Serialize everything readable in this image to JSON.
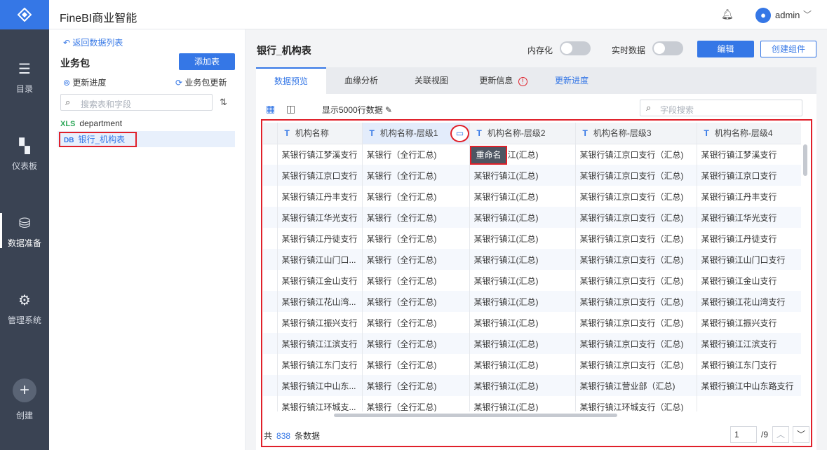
{
  "app": {
    "title": "FineBI商业智能",
    "user": "admin"
  },
  "nav": [
    {
      "label": "目录",
      "icon": "list-icon"
    },
    {
      "label": "仪表板",
      "icon": "dashboard-icon"
    },
    {
      "label": "数据准备",
      "icon": "database-icon"
    },
    {
      "label": "管理系统",
      "icon": "gear-icon"
    },
    {
      "label": "创建",
      "icon": "plus-icon"
    }
  ],
  "sidebar": {
    "back": "返回数据列表",
    "title": "业务包",
    "add_table": "添加表",
    "update_progress": "更新进度",
    "pkg_update": "业务包更新",
    "search_placeholder": "搜索表和字段",
    "items": [
      {
        "label": "department",
        "icon": "xls-icon"
      },
      {
        "label": "银行_机构表",
        "icon": "db-icon"
      }
    ]
  },
  "header": {
    "table_title": "银行_机构表",
    "memory": "内存化",
    "realtime": "实时数据",
    "edit": "编辑",
    "create": "创建组件"
  },
  "tabs": [
    "数据预览",
    "血缘分析",
    "关联视图",
    "更新信息",
    "更新进度"
  ],
  "toolbar": {
    "rows": "显示5000行数据",
    "search_placeholder": "字段搜索"
  },
  "table": {
    "columns": [
      "机构名称",
      "机构名称-层级1",
      "机构名称-层级2",
      "机构名称-层级3",
      "机构名称-层级4"
    ],
    "rows": [
      [
        "某银行镇江梦溪支行",
        "某银行（全行汇总)",
        "某银行镇江(汇总)",
        "某银行镇江京口支行（汇总)",
        "某银行镇江梦溪支行"
      ],
      [
        "某银行镇江京口支行",
        "某银行（全行汇总)",
        "某银行镇江(汇总)",
        "某银行镇江京口支行（汇总)",
        "某银行镇江京口支行"
      ],
      [
        "某银行镇江丹丰支行",
        "某银行（全行汇总)",
        "某银行镇江(汇总)",
        "某银行镇江京口支行（汇总)",
        "某银行镇江丹丰支行"
      ],
      [
        "某银行镇江华光支行",
        "某银行（全行汇总)",
        "某银行镇江(汇总)",
        "某银行镇江京口支行（汇总)",
        "某银行镇江华光支行"
      ],
      [
        "某银行镇江丹徒支行",
        "某银行（全行汇总)",
        "某银行镇江(汇总)",
        "某银行镇江京口支行（汇总)",
        "某银行镇江丹徒支行"
      ],
      [
        "某银行镇江山门口...",
        "某银行（全行汇总)",
        "某银行镇江(汇总)",
        "某银行镇江京口支行（汇总)",
        "某银行镇江山门口支行"
      ],
      [
        "某银行镇江金山支行",
        "某银行（全行汇总)",
        "某银行镇江(汇总)",
        "某银行镇江京口支行（汇总)",
        "某银行镇江金山支行"
      ],
      [
        "某银行镇江花山湾...",
        "某银行（全行汇总)",
        "某银行镇江(汇总)",
        "某银行镇江京口支行（汇总)",
        "某银行镇江花山湾支行"
      ],
      [
        "某银行镇江振兴支行",
        "某银行（全行汇总)",
        "某银行镇江(汇总)",
        "某银行镇江京口支行（汇总)",
        "某银行镇江振兴支行"
      ],
      [
        "某银行镇江江滨支行",
        "某银行（全行汇总)",
        "某银行镇江(汇总)",
        "某银行镇江京口支行（汇总)",
        "某银行镇江江滨支行"
      ],
      [
        "某银行镇江东门支行",
        "某银行（全行汇总)",
        "某银行镇江(汇总)",
        "某银行镇江京口支行（汇总)",
        "某银行镇江东门支行"
      ],
      [
        "某银行镇江中山东...",
        "某银行（全行汇总)",
        "某银行镇江(汇总)",
        "某银行镇江营业部（汇总)",
        "某银行镇江中山东路支行"
      ],
      [
        "某银行镇江环城支...",
        "某银行（全行汇总)",
        "某银行镇江(汇总)",
        "某银行镇江环城支行（汇总)",
        ""
      ]
    ]
  },
  "tooltip": {
    "rename": "重命名"
  },
  "footer": {
    "total_prefix": "共",
    "total_count": "838",
    "total_suffix": "条数据",
    "page": "1",
    "page_total": "/9"
  }
}
